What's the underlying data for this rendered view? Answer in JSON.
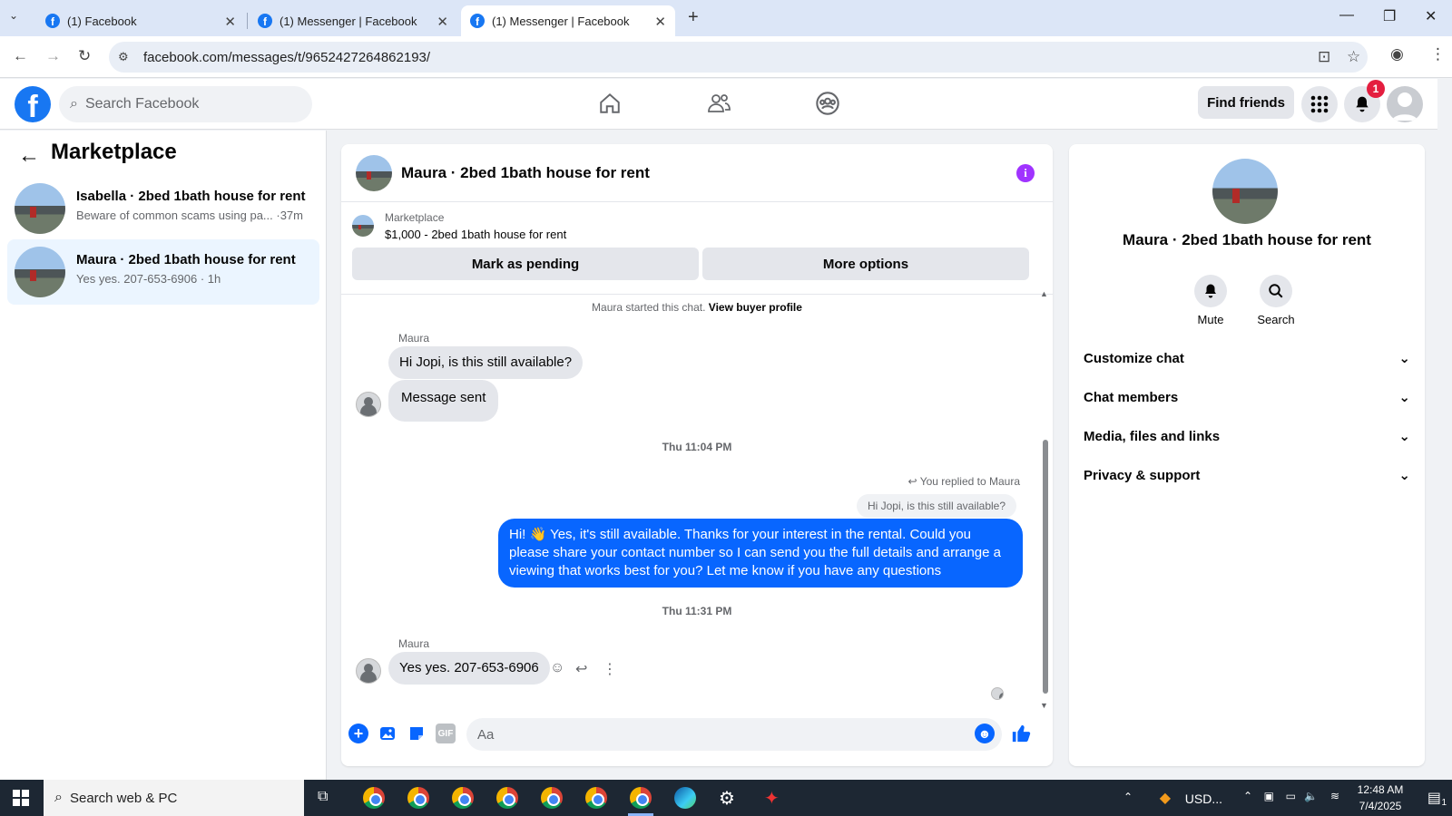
{
  "browser": {
    "tabs": [
      {
        "title": "(1) Facebook"
      },
      {
        "title": "(1) Messenger | Facebook"
      },
      {
        "title": "(1) Messenger | Facebook"
      }
    ],
    "url": "facebook.com/messages/t/9652427264862193/"
  },
  "fb": {
    "search_placeholder": "Search Facebook",
    "find_friends": "Find friends",
    "notif_count": "1"
  },
  "sidebar": {
    "title": "Marketplace",
    "conversations": [
      {
        "title": "Isabella · 2bed 1bath house for rent",
        "preview": "Beware of common scams using pa... ·37m"
      },
      {
        "title": "Maura · 2bed 1bath house for rent",
        "preview": "Yes yes. 207-653-6906 · 1h"
      }
    ]
  },
  "chat": {
    "title": "Maura · 2bed 1bath house for rent",
    "marketplace_label": "Marketplace",
    "listing": "$1,000 - 2bed 1bath house for rent",
    "mark_pending": "Mark as pending",
    "more_options": "More options",
    "started_note": "Maura started this chat.",
    "view_buyer": "View buyer profile",
    "sender1": "Maura",
    "msg1": "Hi Jopi, is this still available?",
    "msg2": "Message sent",
    "ts1": "Thu 11:04 PM",
    "replied_to": "You replied to Maura",
    "quoted": "Hi Jopi, is this still available?",
    "reply": "Hi! 👋 Yes, it's still available. Thanks for your interest in the rental. Could you please share your contact number so I can send you the full details and arrange a viewing that works best for you? Let me know if you have any questions",
    "ts2": "Thu 11:31 PM",
    "sender2": "Maura",
    "msg3": "Yes yes. 207-653-6906",
    "input_placeholder": "Aa"
  },
  "details": {
    "title": "Maura · 2bed 1bath house for rent",
    "mute": "Mute",
    "search": "Search",
    "sections": [
      "Customize chat",
      "Chat members",
      "Media, files and links",
      "Privacy & support"
    ]
  },
  "taskbar": {
    "search": "Search web & PC",
    "currency": "USD...",
    "time": "12:48 AM",
    "date": "7/4/2025",
    "notif": "1"
  }
}
